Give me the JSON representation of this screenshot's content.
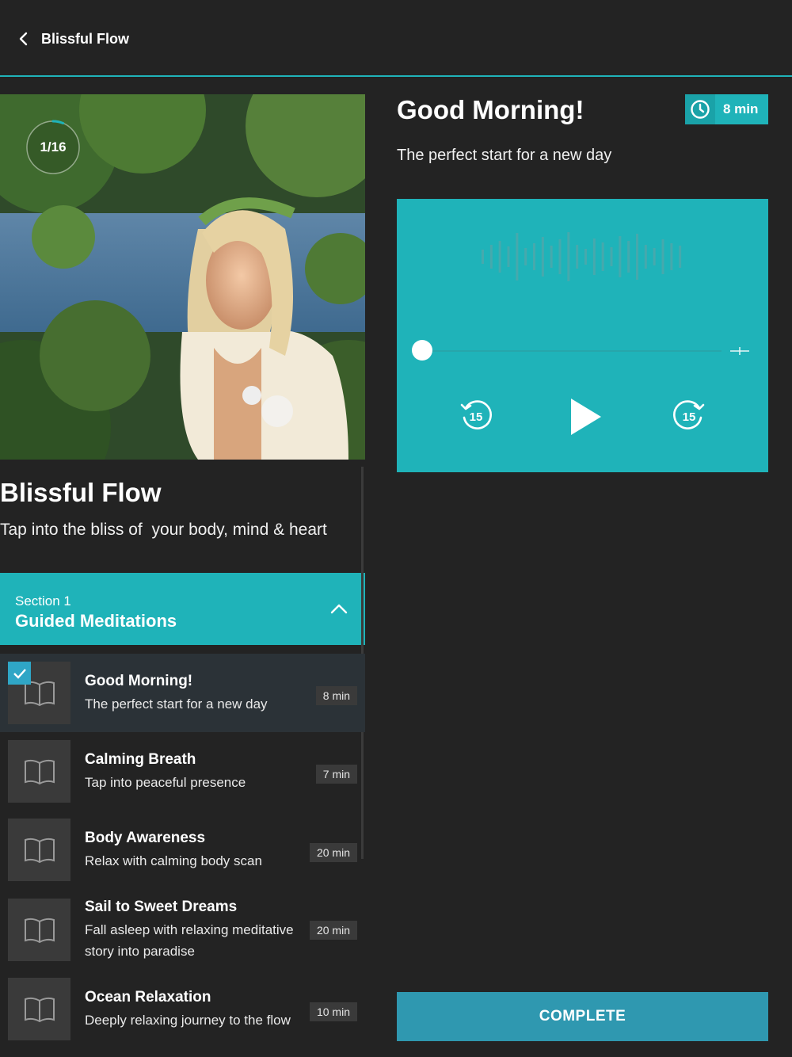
{
  "header": {
    "back_label": "Blissful Flow"
  },
  "course": {
    "progress_text": "1/16",
    "progress_fraction": 0.0625,
    "title": "Blissful Flow",
    "subtitle": "Tap into the bliss of  your body, mind & heart"
  },
  "section": {
    "number_label": "Section 1",
    "name": "Guided Meditations"
  },
  "lessons": [
    {
      "title": "Good Morning!",
      "desc": "The perfect start for a new day",
      "duration": "8 min",
      "completed": true
    },
    {
      "title": "Calming Breath",
      "desc": "Tap into peaceful presence",
      "duration": "7 min",
      "completed": false
    },
    {
      "title": "Body Awareness",
      "desc": "Relax with calming body scan",
      "duration": "20 min",
      "completed": false
    },
    {
      "title": "Sail to Sweet Dreams",
      "desc": "Fall asleep with relaxing meditative story into paradise",
      "duration": "20 min",
      "completed": false
    },
    {
      "title": "Ocean Relaxation",
      "desc": "Deeply relaxing journey to the flow",
      "duration": "10 min",
      "completed": false
    }
  ],
  "current": {
    "title": "Good Morning!",
    "subtitle": "The perfect start for a new day",
    "duration": "8 min"
  },
  "player": {
    "rewind_label": "15",
    "forward_label": "15",
    "position_fraction": 0.0
  },
  "actions": {
    "complete_label": "COMPLETE"
  },
  "colors": {
    "accent": "#1fb3b9",
    "button": "#2f98b0",
    "background": "#232323",
    "check": "#2fa6c6"
  },
  "icons": [
    "chevron-left-icon",
    "clock-icon",
    "book-icon",
    "check-icon",
    "chevron-up-icon",
    "rewind-15-icon",
    "play-icon",
    "forward-15-icon"
  ]
}
